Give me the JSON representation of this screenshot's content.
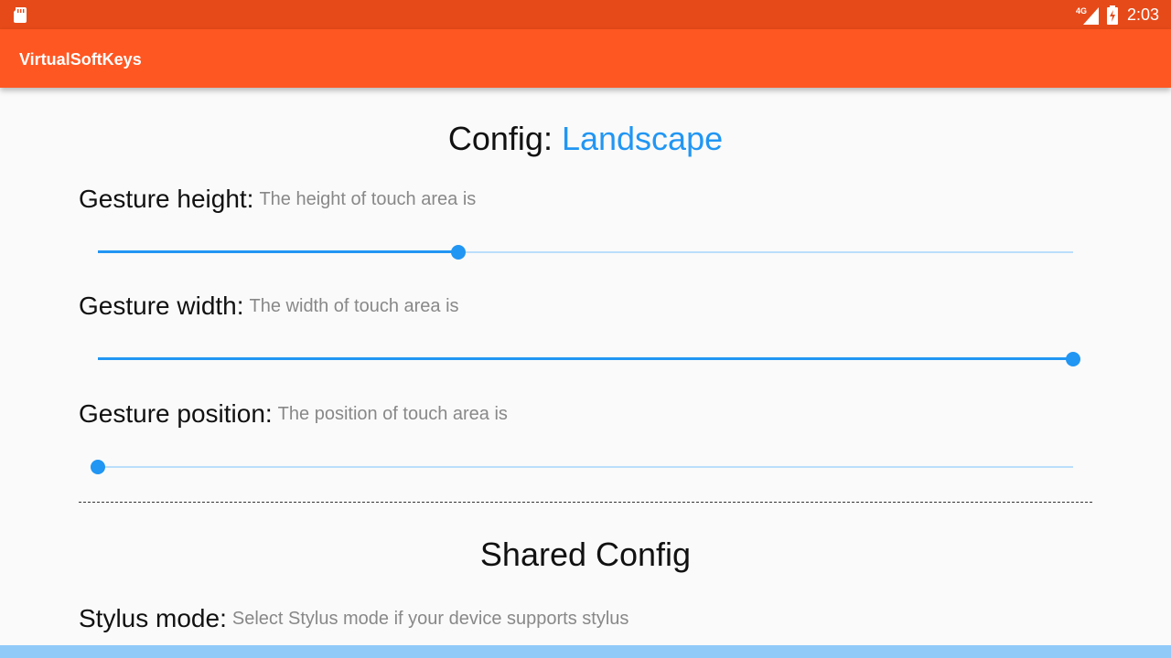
{
  "status_bar": {
    "network_label": "4G",
    "time": "2:03",
    "icons": [
      "sd-card-icon",
      "signal-icon",
      "battery-charging-icon"
    ]
  },
  "app_bar": {
    "title": "VirtualSoftKeys"
  },
  "config": {
    "prefix": "Config:",
    "mode": "Landscape"
  },
  "settings": [
    {
      "label": "Gesture height:",
      "description": "The height of touch area is",
      "slider_fraction": 0.37
    },
    {
      "label": "Gesture width:",
      "description": "The width of touch area is",
      "slider_fraction": 1.0
    },
    {
      "label": "Gesture position:",
      "description": "The position of touch area is",
      "slider_fraction": 0.0
    }
  ],
  "shared": {
    "title": "Shared Config",
    "stylus_label": "Stylus mode:",
    "stylus_description": "Select Stylus mode if your device supports stylus"
  },
  "colors": {
    "status_bar": "#e64a19",
    "app_bar": "#ff5722",
    "accent": "#2196f3",
    "slider_track": "#bbdefb",
    "background": "#fafafa"
  }
}
